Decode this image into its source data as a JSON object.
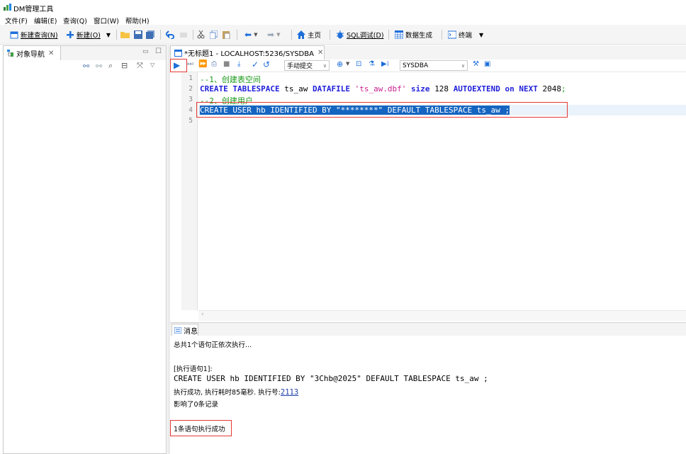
{
  "app": {
    "title": "DM管理工具"
  },
  "menu": [
    "文件(F)",
    "编辑(E)",
    "查询(Q)",
    "窗口(W)",
    "帮助(H)"
  ],
  "toolbar": {
    "new_query": "新建查询(N)",
    "new": "新建(O)",
    "home": "主页",
    "sql_debug": "SQL调试(D)",
    "data_gen": "数据生成",
    "terminal": "终端"
  },
  "nav": {
    "tab_label": "对象导航"
  },
  "editor": {
    "tab_label": "*无标题1 - LOCALHOST:5236/SYSDBA",
    "commit_mode": "手动提交",
    "schema": "SYSDBA",
    "line_numbers": [
      "1",
      "2",
      "3",
      "4",
      "5"
    ],
    "lines": [
      {
        "tokens": [
          {
            "t": "--1、创建表空间",
            "c": "cm"
          }
        ]
      },
      {
        "tokens": [
          {
            "t": "CREATE TABLESPACE ",
            "c": "kw"
          },
          {
            "t": "ts_aw ",
            "c": "nm"
          },
          {
            "t": "DATAFILE ",
            "c": "kw"
          },
          {
            "t": "'ts_aw.dbf'",
            "c": "st"
          },
          {
            "t": " size ",
            "c": "kw"
          },
          {
            "t": "128 ",
            "c": "nm"
          },
          {
            "t": "AUTOEXTEND on NEXT ",
            "c": "kw"
          },
          {
            "t": "2048",
            "c": "nm"
          },
          {
            "t": ";",
            "c": "cm"
          }
        ]
      },
      {
        "tokens": [
          {
            "t": "--2、创建用户",
            "c": "cm"
          }
        ]
      },
      {
        "tokens": [
          {
            "t": "CREATE USER hb IDENTIFIED BY \"********\" DEFAULT TABLESPACE ts_aw ;",
            "c": "sel"
          }
        ]
      },
      {
        "tokens": []
      }
    ]
  },
  "messages": {
    "tab_label": "消息",
    "line1": "总共1个语句正依次执行...",
    "exec_header": "[执行语句1]:",
    "sql": "CREATE USER hb IDENTIFIED BY \"3Chb@2025\" DEFAULT TABLESPACE ts_aw ;",
    "result_prefix": "执行成功, 执行耗时85毫秒. 执行号:",
    "exec_number": "2113",
    "affected": "影响了0条记录",
    "summary": "1条语句执行成功"
  },
  "colors": {
    "accent": "#1f1fd9",
    "highlight": "#1565c0",
    "annotation": "#e53935"
  }
}
